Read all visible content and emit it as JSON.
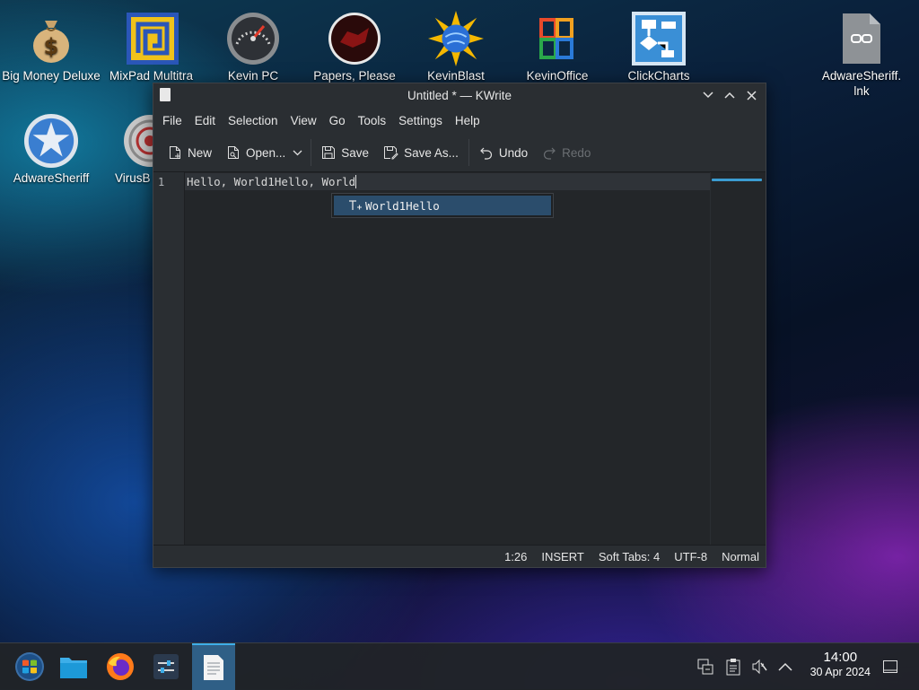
{
  "desktop": {
    "icons": [
      {
        "label": "Big Money Deluxe",
        "icon": "money-bag-icon"
      },
      {
        "label": "MixPad Multitra",
        "icon": "mixpad-icon"
      },
      {
        "label": "Kevin PC",
        "icon": "gauge-icon"
      },
      {
        "label": "Papers, Please",
        "icon": "papers-please-icon"
      },
      {
        "label": "KevinBlast",
        "icon": "sun-globe-icon"
      },
      {
        "label": "KevinOffice",
        "icon": "office-icon"
      },
      {
        "label": "ClickCharts",
        "icon": "flowchart-icon"
      },
      {
        "label": "AdwareSheriff.\nlnk",
        "icon": "link-file-icon"
      },
      {
        "label": "AdwareSheriff",
        "icon": "sheriff-badge-icon"
      },
      {
        "label": "VirusB",
        "icon": "target-icon"
      }
    ]
  },
  "window": {
    "title": "Untitled * — KWrite",
    "menu": [
      "File",
      "Edit",
      "Selection",
      "View",
      "Go",
      "Tools",
      "Settings",
      "Help"
    ],
    "toolbar": {
      "new": "New",
      "open": "Open...",
      "save": "Save",
      "save_as": "Save As...",
      "undo": "Undo",
      "redo": "Redo"
    },
    "editor": {
      "line_number": "1",
      "text": "Hello, World1Hello, World"
    },
    "completion": {
      "item": "World1Hello"
    },
    "status": {
      "cursor": "1:26",
      "mode": "INSERT",
      "indent": "Soft Tabs: 4",
      "encoding": "UTF-8",
      "syntax": "Normal"
    }
  },
  "taskbar": {
    "apps": [
      "start-menu-icon",
      "file-manager-icon",
      "firefox-icon",
      "settings-icon",
      "kwrite-icon"
    ],
    "clock": {
      "time": "14:00",
      "date": "30 Apr 2024"
    }
  }
}
